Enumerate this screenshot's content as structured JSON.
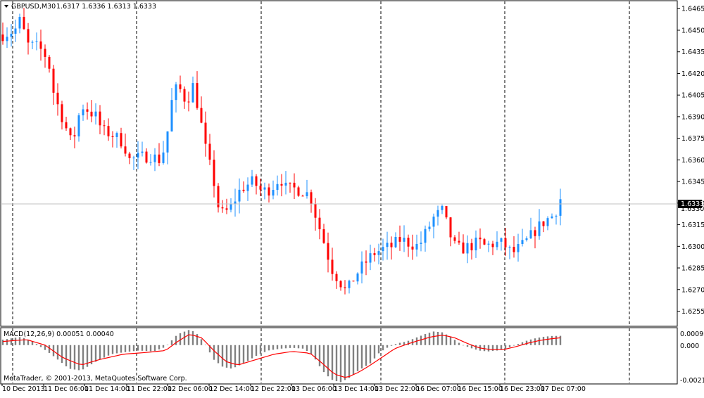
{
  "header": {
    "symbol_label": "GBPUSD,M30",
    "ohlc_label": "1.6317 1.6336 1.6313 1.6333",
    "current_price": "1.6333",
    "current_price_secondary": "1.6330"
  },
  "macd": {
    "label": "MACD(12,26,9) 0.00051 0.00040",
    "ticks": [
      "0.00092",
      "0.000",
      "-0.0021"
    ]
  },
  "copyright": "MetaTrader, © 2001-2013, MetaQuotes Software Corp.",
  "colors": {
    "bull": "#1E90FF",
    "bear": "#FF0000",
    "macd_hist": "#808080",
    "signal": "#FF0000",
    "grid": "#000000",
    "price_line": "#C0C0C0",
    "price_badge": "#000000"
  },
  "chart_data": [
    {
      "type": "candlestick",
      "title": "GBPUSD,M30",
      "ylim": [
        1.6245,
        1.647
      ],
      "yticks": [
        "1.6465",
        "1.6450",
        "1.6435",
        "1.6420",
        "1.6405",
        "1.6390",
        "1.6375",
        "1.6360",
        "1.6345",
        "1.6330",
        "1.6315",
        "1.6300",
        "1.6285",
        "1.6270",
        "1.6255"
      ],
      "xticks": [
        "10 Dec 2013",
        "11 Dec 06:00",
        "11 Dec 14:00",
        "11 Dec 22:00",
        "12 Dec 06:00",
        "12 Dec 14:00",
        "12 Dec 22:00",
        "13 Dec 06:00",
        "13 Dec 14:00",
        "13 Dec 22:00",
        "16 Dec 07:00",
        "16 Dec 15:00",
        "16 Dec 23:00",
        "17 Dec 07:00"
      ],
      "bars": 133,
      "close_path": [
        [
          0,
          1.6447
        ],
        [
          4,
          1.645
        ],
        [
          6,
          1.6458
        ],
        [
          8,
          1.644
        ],
        [
          12,
          1.6438
        ],
        [
          15,
          1.643
        ],
        [
          17,
          1.6405
        ],
        [
          20,
          1.6388
        ],
        [
          23,
          1.637
        ],
        [
          26,
          1.6398
        ],
        [
          28,
          1.6395
        ],
        [
          31,
          1.639
        ],
        [
          33,
          1.638
        ],
        [
          36,
          1.6378
        ],
        [
          40,
          1.6372
        ],
        [
          42,
          1.636
        ],
        [
          46,
          1.6362
        ],
        [
          49,
          1.6363
        ],
        [
          52,
          1.636
        ],
        [
          54,
          1.637
        ],
        [
          56,
          1.64
        ],
        [
          58,
          1.6412
        ],
        [
          61,
          1.64
        ],
        [
          63,
          1.6412
        ],
        [
          65,
          1.6395
        ],
        [
          67,
          1.637
        ],
        [
          70,
          1.6345
        ],
        [
          72,
          1.6322
        ],
        [
          75,
          1.6325
        ],
        [
          79,
          1.634
        ],
        [
          83,
          1.6345
        ],
        [
          86,
          1.6338
        ],
        [
          89,
          1.634
        ],
        [
          92,
          1.6348
        ],
        [
          94,
          1.634
        ],
        [
          97,
          1.634
        ],
        [
          100,
          1.6338
        ],
        [
          102,
          1.6335
        ],
        [
          104,
          1.632
        ],
        [
          107,
          1.63
        ],
        [
          109,
          1.6285
        ],
        [
          112,
          1.6275
        ],
        [
          114,
          1.6268
        ],
        [
          117,
          1.628
        ],
        [
          120,
          1.6288
        ],
        [
          123,
          1.6295
        ],
        [
          126,
          1.6298
        ],
        [
          129,
          1.63
        ],
        [
          132,
          1.6305
        ],
        [
          135,
          1.6302
        ],
        [
          138,
          1.63
        ],
        [
          141,
          1.6312
        ],
        [
          143,
          1.632
        ],
        [
          146,
          1.6325
        ],
        [
          148,
          1.631
        ],
        [
          150,
          1.63
        ],
        [
          152,
          1.6298
        ],
        [
          155,
          1.63
        ],
        [
          158,
          1.6303
        ],
        [
          160,
          1.63
        ],
        [
          163,
          1.6302
        ],
        [
          166,
          1.6302
        ],
        [
          169,
          1.6295
        ],
        [
          172,
          1.63
        ],
        [
          174,
          1.6304
        ],
        [
          177,
          1.6312
        ],
        [
          180,
          1.6318
        ],
        [
          183,
          1.6322
        ],
        [
          185,
          1.6333
        ]
      ]
    },
    {
      "type": "bar+line",
      "title": "MACD(12,26,9)",
      "ylim": [
        -0.0021,
        0.00092
      ],
      "series": [
        {
          "values_path": [
            [
              0,
              0.0003
            ],
            [
              6,
              0.00045
            ],
            [
              10,
              0.0002
            ],
            [
              16,
              -0.0005
            ],
            [
              22,
              -0.0013
            ],
            [
              26,
              -0.0014
            ],
            [
              31,
              -0.0009
            ],
            [
              36,
              -0.0005
            ],
            [
              40,
              -0.0004
            ],
            [
              45,
              -0.0003
            ],
            [
              50,
              -0.00035
            ],
            [
              54,
              -0.0001
            ],
            [
              58,
              0.0006
            ],
            [
              62,
              0.00085
            ],
            [
              64,
              0.0007
            ],
            [
              67,
              0.0001
            ],
            [
              70,
              -0.0008
            ],
            [
              73,
              -0.0012
            ],
            [
              76,
              -0.0013
            ],
            [
              80,
              -0.001
            ],
            [
              84,
              -0.0006
            ],
            [
              88,
              -0.0003
            ],
            [
              92,
              -0.0002
            ],
            [
              96,
              -0.00015
            ],
            [
              100,
              -0.0002
            ],
            [
              103,
              -0.0006
            ],
            [
              106,
              -0.0014
            ],
            [
              109,
              -0.0019
            ],
            [
              112,
              -0.00205
            ],
            [
              115,
              -0.0018
            ],
            [
              118,
              -0.0014
            ],
            [
              122,
              -0.001
            ],
            [
              125,
              -0.0004
            ],
            [
              128,
              -0.0001
            ],
            [
              131,
              0.0001
            ],
            [
              134,
              0.0002
            ],
            [
              137,
              0.0004
            ],
            [
              140,
              0.0006
            ],
            [
              143,
              0.00075
            ],
            [
              146,
              0.0007
            ],
            [
              149,
              0.0004
            ],
            [
              152,
              5e-05
            ],
            [
              155,
              -0.00015
            ],
            [
              158,
              -0.0003
            ],
            [
              161,
              -0.00035
            ],
            [
              164,
              -0.0003
            ],
            [
              167,
              -0.0002
            ],
            [
              170,
              0.0
            ],
            [
              173,
              0.0002
            ],
            [
              176,
              0.00035
            ],
            [
              179,
              0.00045
            ],
            [
              182,
              0.0005
            ],
            [
              185,
              0.00051
            ]
          ]
        },
        {
          "values_path": [
            [
              0,
              0.0002
            ],
            [
              8,
              0.0003
            ],
            [
              14,
              0.0
            ],
            [
              20,
              -0.0007
            ],
            [
              26,
              -0.0011
            ],
            [
              32,
              -0.0008
            ],
            [
              40,
              -0.0005
            ],
            [
              48,
              -0.0004
            ],
            [
              54,
              -0.0003
            ],
            [
              58,
              0.0002
            ],
            [
              62,
              0.0006
            ],
            [
              66,
              0.0004
            ],
            [
              70,
              -0.0003
            ],
            [
              74,
              -0.0009
            ],
            [
              78,
              -0.0011
            ],
            [
              84,
              -0.0008
            ],
            [
              90,
              -0.0005
            ],
            [
              96,
              -0.00035
            ],
            [
              102,
              -0.00045
            ],
            [
              106,
              -0.001
            ],
            [
              110,
              -0.0016
            ],
            [
              114,
              -0.0018
            ],
            [
              118,
              -0.0015
            ],
            [
              122,
              -0.0011
            ],
            [
              126,
              -0.00065
            ],
            [
              130,
              -0.0002
            ],
            [
              134,
              5e-05
            ],
            [
              138,
              0.00025
            ],
            [
              142,
              0.00045
            ],
            [
              146,
              0.00055
            ],
            [
              150,
              0.0004
            ],
            [
              154,
              0.0001
            ],
            [
              158,
              -0.00015
            ],
            [
              162,
              -0.00025
            ],
            [
              166,
              -0.00025
            ],
            [
              170,
              -0.0001
            ],
            [
              174,
              0.0001
            ],
            [
              178,
              0.00025
            ],
            [
              182,
              0.00035
            ],
            [
              185,
              0.0004
            ]
          ]
        }
      ]
    }
  ]
}
